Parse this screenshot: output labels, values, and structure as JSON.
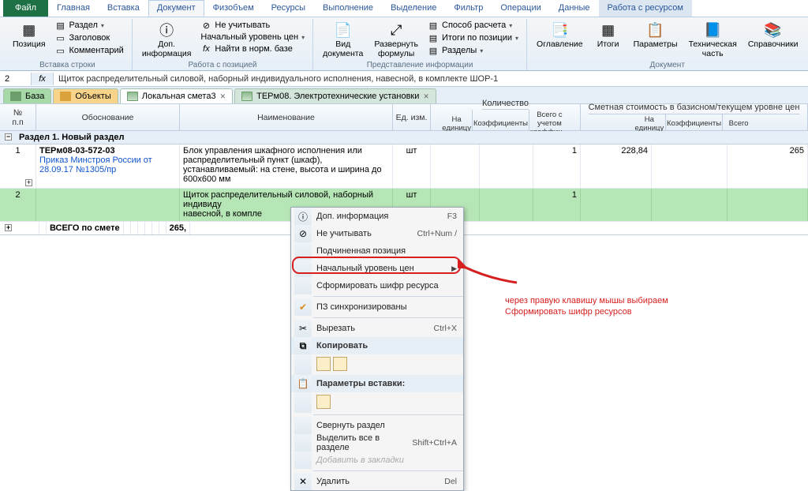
{
  "ribbon": {
    "tabs": {
      "file": "Файл",
      "home": "Главная",
      "insert": "Вставка",
      "document": "Документ",
      "fizobem": "Физобъем",
      "resources": "Ресурсы",
      "execution": "Выполнение",
      "selection": "Выделение",
      "filter": "Фильтр",
      "operations": "Операции",
      "data": "Данные",
      "work_resource": "Работа с ресурсом"
    },
    "group_insert_row": {
      "title": "Вставка строки",
      "position": "Позиция",
      "section": "Раздел",
      "header": "Заголовок",
      "comment": "Комментарий"
    },
    "group_work_pos": {
      "title": "Работа с позицией",
      "dop_info": "Доп.\nинформация",
      "ne_uchit": "Не учитывать",
      "nach_uroven": "Начальный уровень цен",
      "find_norm": "Найти в норм. базе"
    },
    "group_pred_info": {
      "title": "Представление информации",
      "vid_doc": "Вид\nдокумента",
      "razvernut": "Развернуть\nформулы",
      "sposob": "Способ расчета",
      "itogi_pos": "Итоги по позиции",
      "razdely": "Разделы"
    },
    "group_doc": {
      "title": "Документ",
      "oglavlenie": "Оглавление",
      "itogi": "Итоги",
      "parametry": "Параметры",
      "tech_chast": "Техническая\nчасть",
      "sprav": "Справочники"
    }
  },
  "formula": {
    "cell": "2",
    "fx": "fx",
    "text": "Щиток распределительный силовой, наборный индивидуального исполнения, навесной, в комплекте ШОР-1"
  },
  "doc_tabs": {
    "base": "База",
    "objects": "Объекты",
    "smeta": "Локальная смета3",
    "term": "ТЕРм08. Электротехнические установки"
  },
  "grid_headers": {
    "num": "№\nп.п",
    "obos": "Обоснование",
    "name": "Наименование",
    "ed": "Ед. изм.",
    "qty": "Количество",
    "qty_ed": "На\nединицу",
    "qty_koef": "Коэффициенты",
    "qty_vsego": "Всего с\nучетом\nкоэффиц...",
    "cost": "Сметная стоимость в базисном/текущем уровне цен",
    "cost_ed": "На единицу",
    "cost_koef": "Коэффициенты",
    "cost_vsego": "Всего"
  },
  "grid": {
    "section": "Раздел 1. Новый раздел",
    "row1": {
      "num": "1",
      "code": "ТЕРм08-03-572-03",
      "doc": "Приказ Минстроя России от 28.09.17 №1305/пр",
      "name": "Блок управления шкафного исполнения или распределительный пункт (шкаф), устанавливаемый: на стене, высота и ширина до 600х600 мм",
      "ed": "шт",
      "qty": "1",
      "cost_ed": "228,84",
      "cost_vsego": "265"
    },
    "row2": {
      "num": "2",
      "name": "Щиток распределительный силовой, наборный индивиду\nнавесной, в компле",
      "ed": "шт",
      "qty": "1"
    },
    "total": {
      "label": "ВСЕГО по смете",
      "value": "265,"
    }
  },
  "context_menu": {
    "dop_info": "Доп. информация",
    "dop_info_sc": "F3",
    "ne_uchit": "Не учитывать",
    "ne_uchit_sc": "Ctrl+Num /",
    "podchin": "Подчиненная позиция",
    "nach_uroven": "Начальный уровень цен",
    "sform_shifr": "Сформировать шифр ресурса",
    "pz_sync": "ПЗ синхронизированы",
    "vyrezat": "Вырезать",
    "vyrezat_sc": "Ctrl+X",
    "kopirovat": "Копировать",
    "param_vstavki": "Параметры вставки:",
    "svernut": "Свернуть раздел",
    "vydelit_vse": "Выделить все в разделе",
    "vydelit_sc": "Shift+Ctrl+A",
    "dobavit_zakl": "Добавить в закладки",
    "udalit": "Удалить",
    "udalit_sc": "Del"
  },
  "annotation": {
    "line1": "через правую клавишу мышы выбираем",
    "line2": "Сформировать шифр ресурсов"
  }
}
